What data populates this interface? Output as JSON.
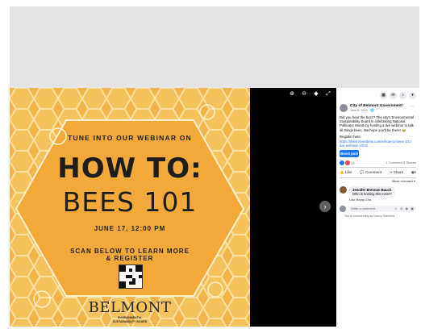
{
  "poster": {
    "line1": "TUNE INTO OUR WEBINAR ON",
    "title1": "HOW TO:",
    "title2": "BEES 101",
    "date": "JUNE 17, 12:00 PM",
    "cta1": "SCAN BELOW TO LEARN MORE",
    "cta2": "& REGISTER",
    "logo": "BELMONT",
    "logo_sub1": "ENVIRONMENTAL",
    "logo_sub2": "SUSTAINABILITY BOARD"
  },
  "viewer": {
    "icons": [
      "zoom-in-icon",
      "zoom-out-icon",
      "tag-icon",
      "fullscreen-icon"
    ],
    "next_icon": "chevron-right-icon"
  },
  "sidebar": {
    "top_icons": [
      "menu-grid-icon",
      "messenger-icon",
      "bell-icon",
      "account-caret-icon"
    ],
    "page_name": "City of Belmont Government",
    "post_date": "June 8, 2021 · 🌐",
    "post_text": "Did you hear the buzz? The city's Environmental Sustainability Board is celebrating National Pollinator Month by hosting a live webinar to talk all things bees. We hope you'll be there! 🐝",
    "register_label": "Register here:",
    "register_link": "https://www.eventbrite.com/e/how-to-bees-101-live-webinar-1003/",
    "boost_label": "Boost post",
    "reaction_count": "19",
    "comments_shares": "1 Comment 3 Shares",
    "actions": {
      "like": "Like",
      "comment": "Comment",
      "share": "Share"
    },
    "most_relevant": "Most relevant ▾",
    "comment": {
      "author": "Jennifer Brennan Bauch",
      "text": "Who is hosting this event?",
      "meta": "Like  Reply  27w"
    },
    "write_placeholder": "Write a comment...",
    "write_icons": "☺ ◎ ◉ ▣",
    "commenting_as": "You're commenting as Nancy Stamford"
  },
  "colors": {
    "poster_bg": "#f3b54b",
    "accent": "#1877f2"
  }
}
